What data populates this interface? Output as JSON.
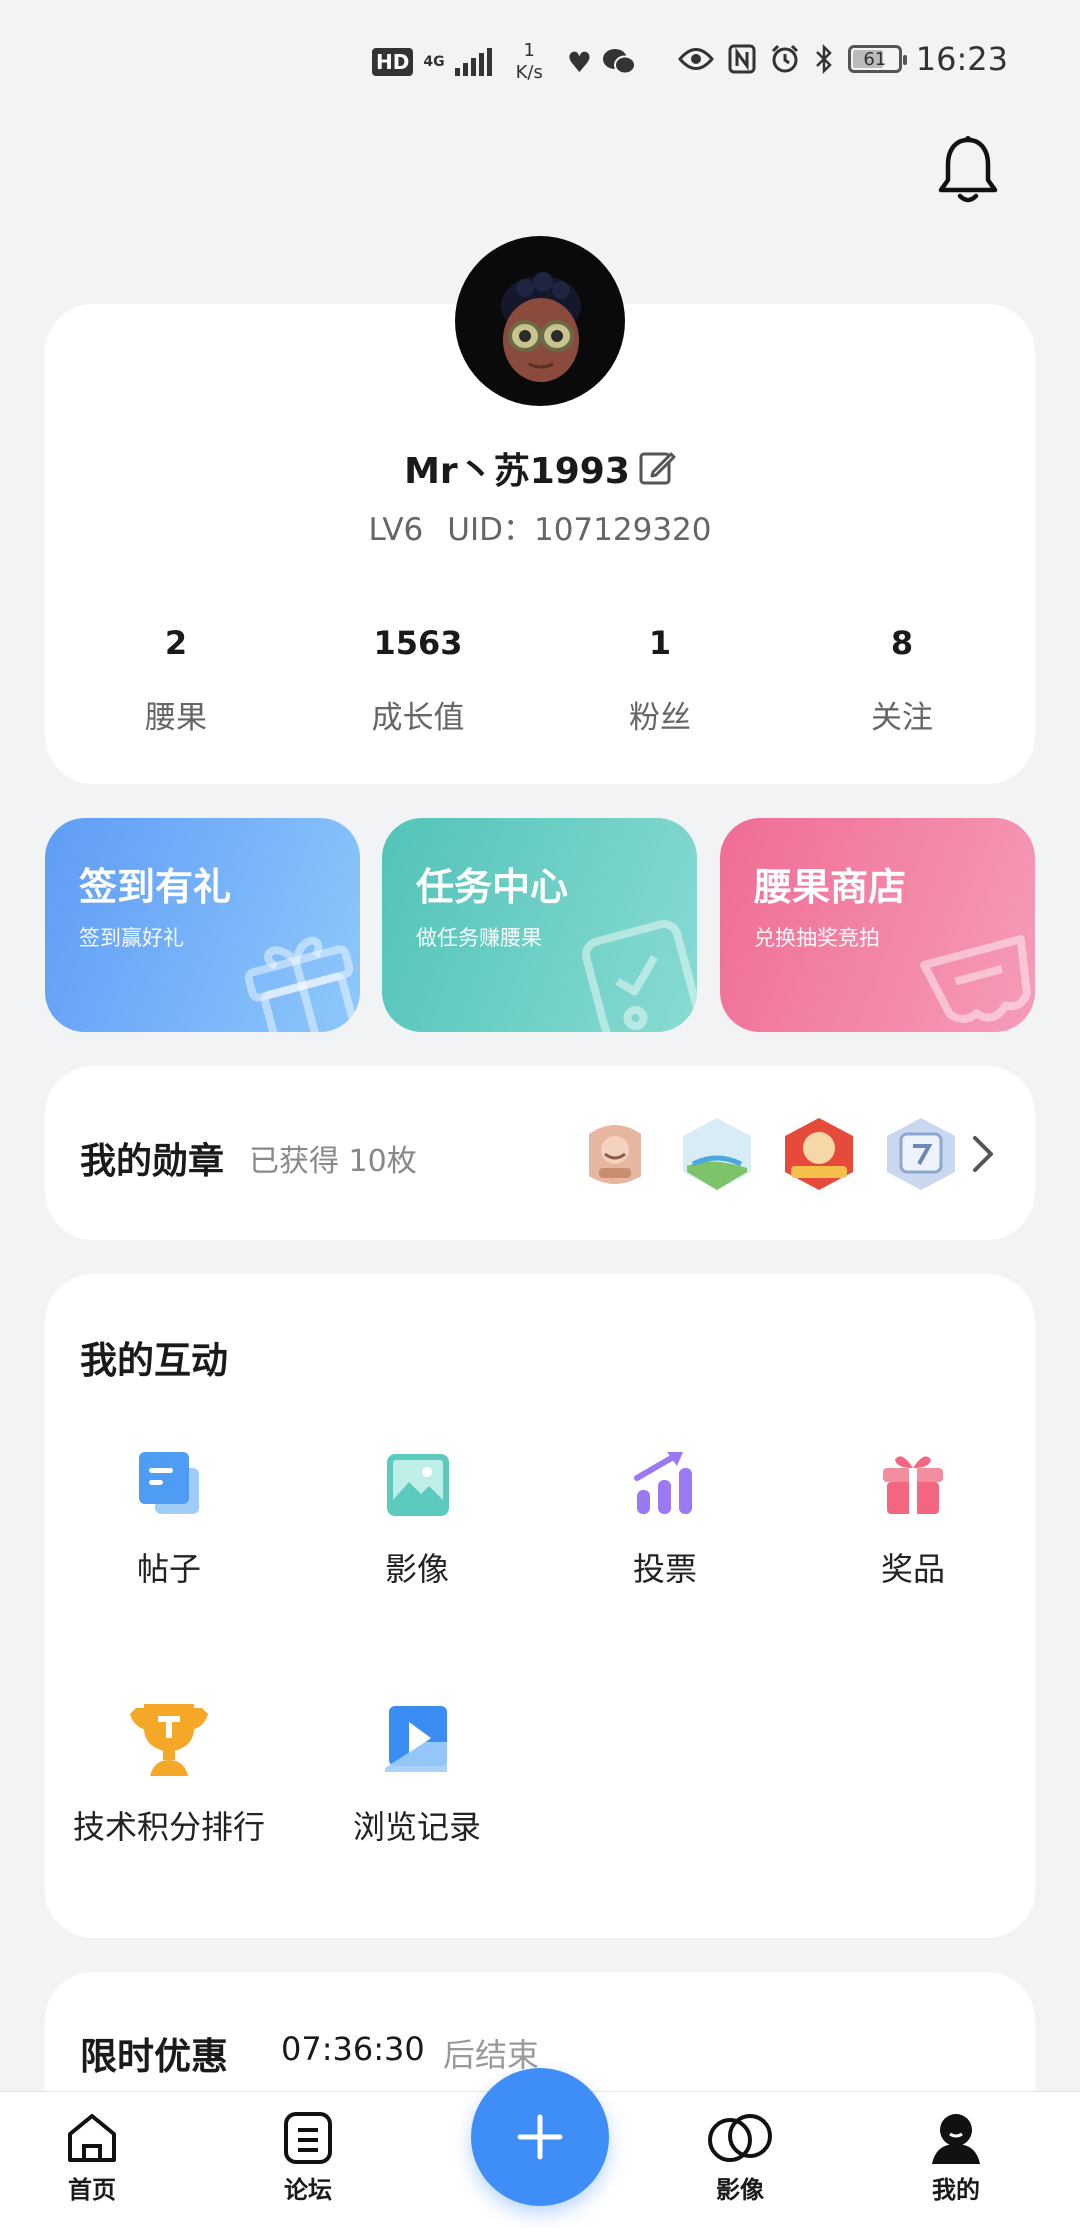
{
  "status_bar": {
    "hd": "HD",
    "net_gen": "4G",
    "speed_value": "1",
    "speed_unit": "K/s",
    "battery": "61",
    "time": "16:23"
  },
  "profile": {
    "username": "Mr丶苏1993",
    "level": "LV6",
    "uid": "UID：107129320",
    "stats": [
      {
        "value": "2",
        "label": "腰果"
      },
      {
        "value": "1563",
        "label": "成长值"
      },
      {
        "value": "1",
        "label": "粉丝"
      },
      {
        "value": "8",
        "label": "关注"
      }
    ]
  },
  "quick_tiles": [
    {
      "title": "签到有礼",
      "subtitle": "签到赢好礼",
      "color": "#5f9cf6"
    },
    {
      "title": "任务中心",
      "subtitle": "做任务赚腰果",
      "color": "#52c3b8"
    },
    {
      "title": "腰果商店",
      "subtitle": "兑换抽奖竞拍",
      "color": "#f06c93"
    }
  ],
  "medals": {
    "title": "我的勋章",
    "count": "已获得 10枚"
  },
  "interactions": {
    "title": "我的互动",
    "items": [
      {
        "label": "帖子",
        "icon": "posts-icon"
      },
      {
        "label": "影像",
        "icon": "image-icon"
      },
      {
        "label": "投票",
        "icon": "vote-icon"
      },
      {
        "label": "奖品",
        "icon": "gift-icon"
      },
      {
        "label": "技术积分排行",
        "icon": "trophy-icon"
      },
      {
        "label": "浏览记录",
        "icon": "history-icon"
      }
    ]
  },
  "offer": {
    "title": "限时优惠",
    "countdown": "07:36:30",
    "suffix": "后结束"
  },
  "nav": {
    "items": [
      {
        "label": "首页",
        "icon": "home-icon"
      },
      {
        "label": "论坛",
        "icon": "forum-icon"
      },
      {
        "label": "影像",
        "icon": "gallery-icon"
      },
      {
        "label": "我的",
        "icon": "profile-icon"
      }
    ]
  },
  "colors": {
    "accent": "#3f8df7",
    "background": "#f2f3f5"
  }
}
